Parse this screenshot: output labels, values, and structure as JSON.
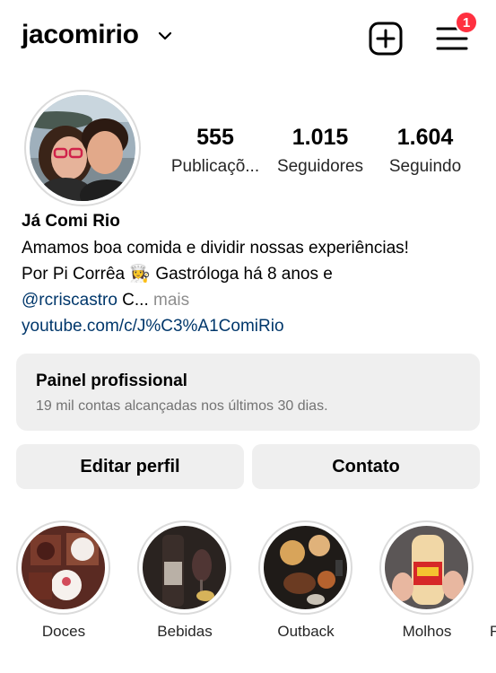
{
  "header": {
    "username": "jacomirio",
    "notification_count": "1"
  },
  "profile": {
    "display_name": "Já Comi Rio",
    "bio_line1": "Amamos boa comida e dividir nossas experiências!",
    "bio_line2_a": "Por Pi Corrêa ",
    "bio_emoji": "👩‍🍳",
    "bio_line2_b": " Gastróloga há 8 anos e",
    "mention": "@rcriscastro",
    "bio_line3_rest": " C...",
    "more_label": " mais",
    "website": "youtube.com/c/J%C3%A1ComiRio"
  },
  "stats": [
    {
      "value": "555",
      "label": "Publicaçõ..."
    },
    {
      "value": "1.015",
      "label": "Seguidores"
    },
    {
      "value": "1.604",
      "label": "Seguindo"
    }
  ],
  "dashboard": {
    "title": "Painel profissional",
    "subtitle": "19 mil contas alcançadas nos últimos 30 dias."
  },
  "actions": {
    "edit_profile": "Editar perfil",
    "contact": "Contato"
  },
  "highlights": [
    {
      "label": "Doces"
    },
    {
      "label": "Bebidas"
    },
    {
      "label": "Outback"
    },
    {
      "label": "Molhos"
    },
    {
      "label": "F"
    }
  ]
}
